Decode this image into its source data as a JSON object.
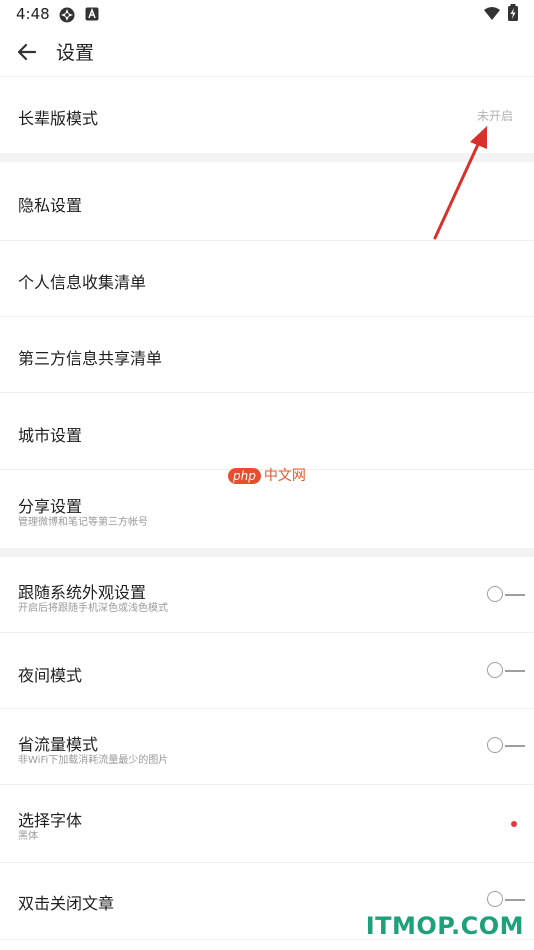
{
  "status_bar": {
    "time": "4:48"
  },
  "header": {
    "title": "设置"
  },
  "settings": {
    "elder_mode": {
      "title": "长辈版模式",
      "value": "未开启"
    },
    "privacy": {
      "title": "隐私设置"
    },
    "personal_info": {
      "title": "个人信息收集清单"
    },
    "third_party": {
      "title": "第三方信息共享清单"
    },
    "city": {
      "title": "城市设置"
    },
    "share": {
      "title": "分享设置",
      "subtitle": "管理微博和笔记等第三方帐号"
    },
    "follow_system": {
      "title": "跟随系统外观设置",
      "subtitle": "开启后将跟随手机深色或浅色模式",
      "enabled": false
    },
    "night_mode": {
      "title": "夜间模式",
      "enabled": false
    },
    "data_saver": {
      "title": "省流量模式",
      "subtitle": "非WiFi下加载消耗流量最少的图片",
      "enabled": false
    },
    "font": {
      "title": "选择字体",
      "subtitle": "黑体"
    },
    "double_tap_close": {
      "title": "双击关闭文章",
      "enabled": false
    }
  },
  "watermark": {
    "php": "php",
    "cn": "中文网"
  },
  "footer_logo": "ITMOP.COM",
  "colors": {
    "accent_red": "#e5393b",
    "arrow_red": "#d9302c",
    "logo_green": "#1ea17a"
  }
}
